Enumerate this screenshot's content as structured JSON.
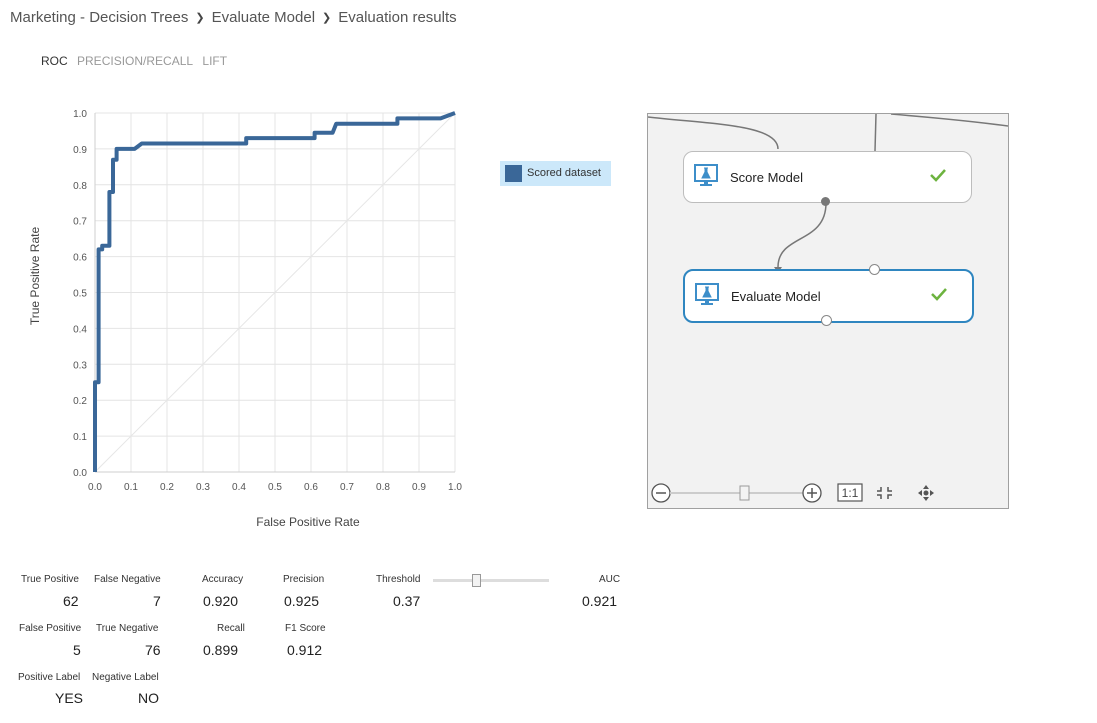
{
  "breadcrumb": {
    "items": [
      "Marketing - Decision Trees",
      "Evaluate Model",
      "Evaluation results"
    ]
  },
  "tabs": [
    {
      "label": "ROC",
      "active": true
    },
    {
      "label": "PRECISION/RECALL",
      "active": false
    },
    {
      "label": "LIFT",
      "active": false
    }
  ],
  "chart_data": {
    "type": "line",
    "title": "",
    "xlabel": "False Positive Rate",
    "ylabel": "True Positive Rate",
    "xlim": [
      0,
      1
    ],
    "ylim": [
      0,
      1
    ],
    "x_ticks": [
      "0.0",
      "0.1",
      "0.2",
      "0.3",
      "0.4",
      "0.5",
      "0.6",
      "0.7",
      "0.8",
      "0.9",
      "1.0"
    ],
    "y_ticks": [
      "0.0",
      "0.1",
      "0.2",
      "0.3",
      "0.4",
      "0.5",
      "0.6",
      "0.7",
      "0.8",
      "0.9",
      "1.0"
    ],
    "grid": true,
    "legend_position": "right",
    "diagonal_reference": true,
    "series": [
      {
        "name": "Scored dataset",
        "color": "#3a6798",
        "x": [
          0,
          0,
          0.01,
          0.01,
          0.02,
          0.02,
          0.04,
          0.04,
          0.05,
          0.05,
          0.06,
          0.06,
          0.08,
          0.11,
          0.13,
          0.42,
          0.42,
          0.61,
          0.61,
          0.66,
          0.67,
          0.84,
          0.84,
          0.96,
          1.0
        ],
        "y": [
          0,
          0.25,
          0.25,
          0.62,
          0.62,
          0.63,
          0.63,
          0.78,
          0.78,
          0.87,
          0.87,
          0.9,
          0.9,
          0.9,
          0.915,
          0.915,
          0.93,
          0.93,
          0.945,
          0.945,
          0.97,
          0.97,
          0.985,
          0.985,
          1.0
        ]
      }
    ]
  },
  "legend": {
    "label": "Scored dataset",
    "color": "#3a6798"
  },
  "canvas": {
    "modules": [
      {
        "label": "Score Model",
        "icon": "flask-monitor-icon",
        "status": "check-icon"
      },
      {
        "label": "Evaluate Model",
        "icon": "flask-monitor-icon",
        "status": "check-icon"
      }
    ],
    "zoom_controls": {
      "zoom_out": "zoom-out-icon",
      "zoom_in": "zoom-in-icon",
      "actual_size": "1:1",
      "fit": "fit-icon",
      "pan": "pan-icon"
    }
  },
  "stats": {
    "true_positive": {
      "label": "True Positive",
      "value": "62"
    },
    "false_negative": {
      "label": "False Negative",
      "value": "7"
    },
    "accuracy": {
      "label": "Accuracy",
      "value": "0.920"
    },
    "precision": {
      "label": "Precision",
      "value": "0.925"
    },
    "threshold": {
      "label": "Threshold",
      "value": "0.37"
    },
    "auc": {
      "label": "AUC",
      "value": "0.921"
    },
    "false_positive": {
      "label": "False Positive",
      "value": "5"
    },
    "true_negative": {
      "label": "True Negative",
      "value": "76"
    },
    "recall": {
      "label": "Recall",
      "value": "0.899"
    },
    "f1_score": {
      "label": "F1 Score",
      "value": "0.912"
    },
    "positive_label": {
      "label": "Positive Label",
      "value": "YES"
    },
    "negative_label": {
      "label": "Negative Label",
      "value": "NO"
    }
  }
}
